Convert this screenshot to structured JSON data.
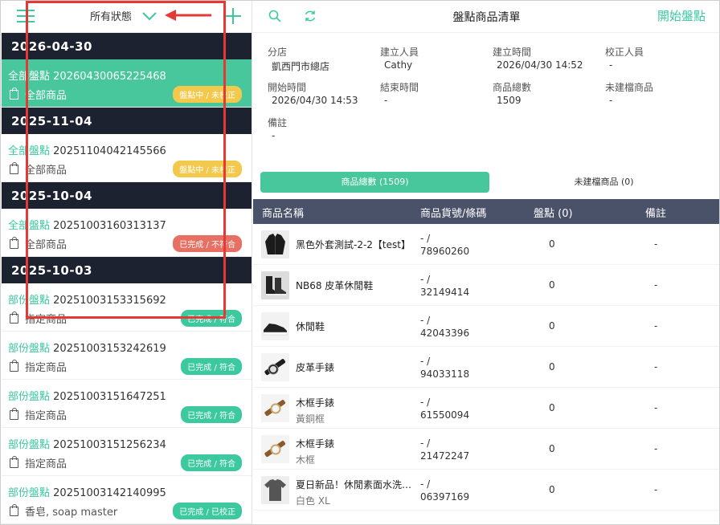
{
  "left": {
    "filter_label": "所有狀態",
    "groups": [
      {
        "date": "2026-04-30",
        "items": [
          {
            "type": "全部盤點",
            "id": "20260430065225468",
            "scope": "全部商品",
            "status": "盤點中 / 未校正",
            "status_color": "yellow",
            "active": true
          }
        ]
      },
      {
        "date": "2025-11-04",
        "items": [
          {
            "type": "全部盤點",
            "id": "20251104042145566",
            "scope": "全部商品",
            "status": "盤點中 / 未校正",
            "status_color": "yellow",
            "active": false
          }
        ]
      },
      {
        "date": "2025-10-04",
        "items": [
          {
            "type": "全部盤點",
            "id": "20251003160313137",
            "scope": "全部商品",
            "status": "已完成 / 不符合",
            "status_color": "red",
            "active": false
          }
        ]
      },
      {
        "date": "2025-10-03",
        "items": [
          {
            "type": "部份盤點",
            "id": "20251003153315692",
            "scope": "指定商品",
            "status": "已完成 / 符合",
            "status_color": "green",
            "active": false
          },
          {
            "type": "部份盤點",
            "id": "20251003153242619",
            "scope": "指定商品",
            "status": "已完成 / 符合",
            "status_color": "green",
            "active": false
          },
          {
            "type": "部份盤點",
            "id": "20251003151647251",
            "scope": "指定商品",
            "status": "已完成 / 符合",
            "status_color": "green",
            "active": false
          },
          {
            "type": "部份盤點",
            "id": "20251003151256234",
            "scope": "指定商品",
            "status": "已完成 / 符合",
            "status_color": "green",
            "active": false
          },
          {
            "type": "部份盤點",
            "id": "20251003142140995",
            "scope": "香皂, soap master",
            "status": "已完成 / 已校正",
            "status_color": "green",
            "active": false
          }
        ]
      }
    ]
  },
  "right": {
    "title": "盤點商品清單",
    "start_label": "開始盤點",
    "info": [
      {
        "label": "分店",
        "value": "凱西門市總店"
      },
      {
        "label": "建立人員",
        "value": "Cathy"
      },
      {
        "label": "建立時間",
        "value": "2026/04/30 14:52"
      },
      {
        "label": "校正人員",
        "value": "-"
      },
      {
        "label": "開始時間",
        "value": "2026/04/30 14:53"
      },
      {
        "label": "結束時間",
        "value": "-"
      },
      {
        "label": "商品總數",
        "value": "1509"
      },
      {
        "label": "未建檔商品",
        "value": "-"
      },
      {
        "label": "備註",
        "value": "-"
      }
    ],
    "tabs": [
      {
        "label": "商品總數 (1509)",
        "active": true
      },
      {
        "label": "未建檔商品 (0)",
        "active": false
      }
    ],
    "columns": [
      "商品名稱",
      "商品貨號/條碼",
      "盤點 (0)",
      "備註"
    ],
    "products": [
      {
        "name": "黑色外套測試-2-2【test】",
        "variant": "",
        "code1": "- /",
        "code2": "78960260",
        "count": "0",
        "note": "-",
        "thumb": "jacket"
      },
      {
        "name": "NB68 皮革休閒鞋",
        "variant": "",
        "code1": "- /",
        "code2": "32149414",
        "count": "0",
        "note": "-",
        "thumb": "boots"
      },
      {
        "name": "休閒鞋",
        "variant": "",
        "code1": "- /",
        "code2": "42043396",
        "count": "0",
        "note": "-",
        "thumb": "sneaker"
      },
      {
        "name": "皮革手錶",
        "variant": "",
        "code1": "- /",
        "code2": "94033118",
        "count": "0",
        "note": "-",
        "thumb": "watch-black"
      },
      {
        "name": "木框手錶",
        "variant": "黃銅框",
        "code1": "- /",
        "code2": "61550094",
        "count": "0",
        "note": "-",
        "thumb": "watch-wood"
      },
      {
        "name": "木框手錶",
        "variant": "木框",
        "code1": "- /",
        "code2": "21472247",
        "count": "0",
        "note": "-",
        "thumb": "watch-wood"
      },
      {
        "name": "夏日新品！休閒素面水洗T恤",
        "variant": "白色 XL",
        "code1": "- /",
        "code2": "06397169",
        "count": "0",
        "note": "-",
        "thumb": "tshirt"
      }
    ]
  }
}
